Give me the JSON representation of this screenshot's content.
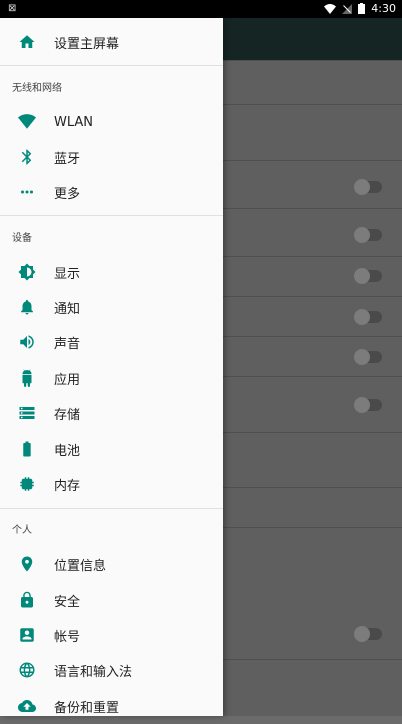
{
  "status": {
    "left": "⊠",
    "time": "4:30"
  },
  "drawer": {
    "home": "设置主屏幕",
    "sections": [
      {
        "title": "无线和网络",
        "items": [
          "WLAN",
          "蓝牙",
          "更多"
        ]
      },
      {
        "title": "设备",
        "items": [
          "显示",
          "通知",
          "声音",
          "应用",
          "存储",
          "电池",
          "内存"
        ]
      },
      {
        "title": "个人",
        "items": [
          "位置信息",
          "安全",
          "帐号",
          "语言和输入法",
          "备份和重置"
        ]
      }
    ]
  },
  "colors": {
    "accent": "#00897b",
    "drawer_bg": "#fafafa"
  },
  "toggles": [
    {
      "checked": false
    },
    {
      "checked": false
    },
    {
      "checked": false
    },
    {
      "checked": false
    },
    {
      "checked": false
    },
    {
      "checked": false
    },
    {
      "checked": false
    }
  ]
}
